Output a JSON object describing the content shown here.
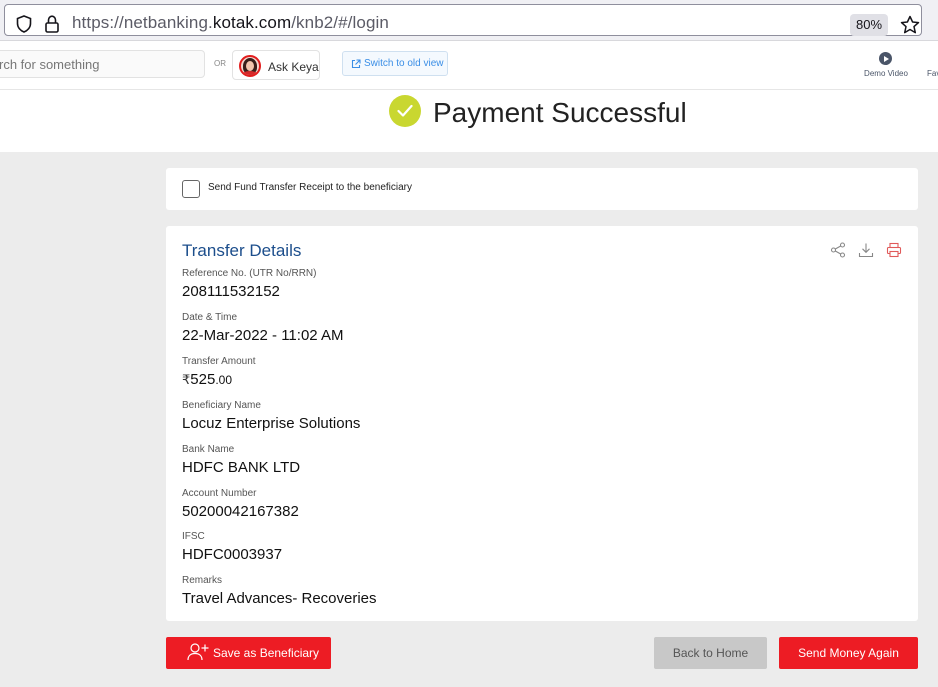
{
  "browser": {
    "url_prefix": "https://netbanking.",
    "url_host": "kotak.com",
    "url_path": "/knb2/#/login",
    "zoom": "80%"
  },
  "header": {
    "search_placeholder": "rch for something",
    "or_text": "OR",
    "ask_keya": "Ask Keya",
    "switch_old_view": "Switch to old view",
    "demo_video": "Demo Video",
    "fav": "Fav"
  },
  "success": {
    "title": "Payment Successful",
    "accent_color": "#c9d730"
  },
  "receipt": {
    "label": "Send Fund Transfer Receipt to the beneficiary",
    "checked": false
  },
  "details": {
    "title": "Transfer Details",
    "icons": [
      "share-icon",
      "download-icon",
      "print-icon"
    ],
    "reference_label": "Reference No. (UTR No/RRN)",
    "reference_value": "208111532152",
    "datetime_label": "Date & Time",
    "datetime_value": "22-Mar-2022 - 11:02 AM",
    "amount_label": "Transfer Amount",
    "amount_symbol": "₹",
    "amount_whole": "525",
    "amount_paise": ".00",
    "beneficiary_label": "Beneficiary Name",
    "beneficiary_value": "Locuz Enterprise Solutions",
    "bank_label": "Bank Name",
    "bank_value": "HDFC BANK LTD",
    "account_label": "Account Number",
    "account_value": "50200042167382",
    "ifsc_label": "IFSC",
    "ifsc_value": "HDFC0003937",
    "remarks_label": "Remarks",
    "remarks_value": "Travel Advances- Recoveries"
  },
  "actions": {
    "save_beneficiary": "Save as Beneficiary",
    "back_home": "Back to Home",
    "send_again": "Send Money Again",
    "primary_color": "#ed1c24"
  }
}
